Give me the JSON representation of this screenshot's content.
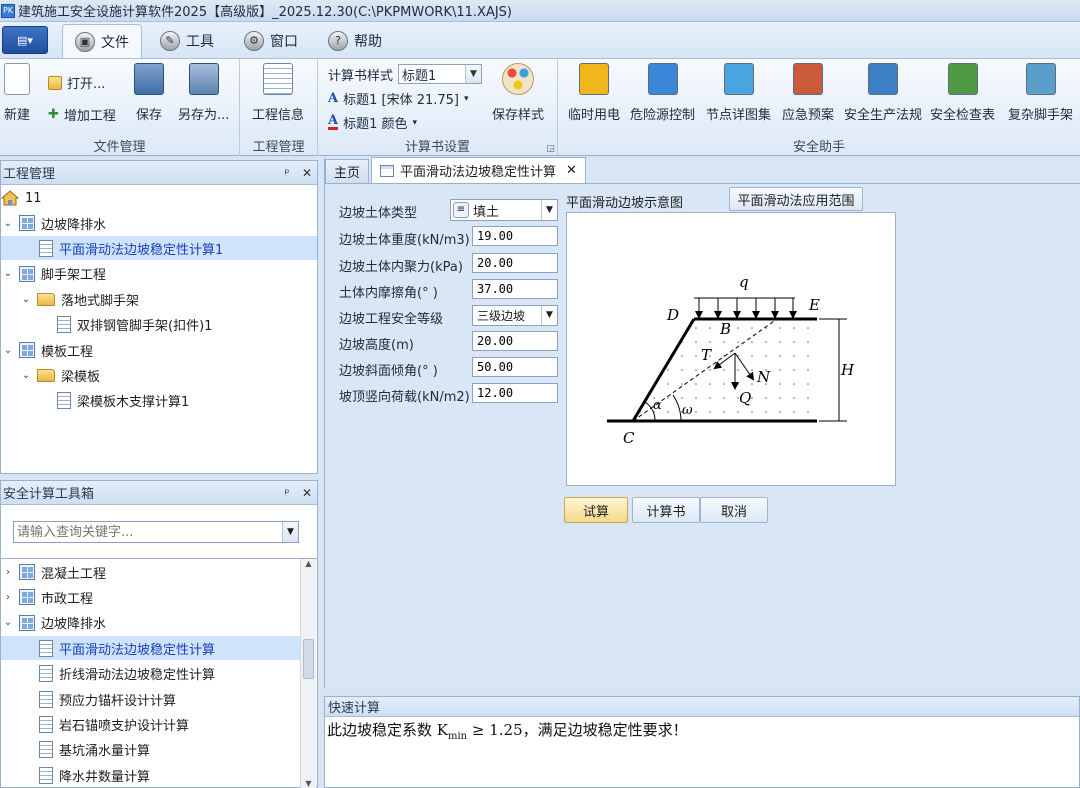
{
  "app": {
    "title": "建筑施工安全设施计算软件2025【高级版】_2025.12.30(C:\\PKPMWORK\\11.XAJS)",
    "icon_label": "PK"
  },
  "menu": {
    "app_button": "▤▾",
    "tabs": [
      {
        "label": "文件",
        "icon": "file-icon"
      },
      {
        "label": "工具",
        "icon": "wrench-icon"
      },
      {
        "label": "窗口",
        "icon": "gear-icon"
      },
      {
        "label": "帮助",
        "icon": "help-icon"
      }
    ]
  },
  "ribbon": {
    "file_group": {
      "label": "文件管理",
      "new": "新建",
      "open": "打开...",
      "add_project": "增加工程",
      "save": "保存",
      "save_as": "另存为..."
    },
    "project_group": {
      "label": "工程管理",
      "project_info": "工程信息"
    },
    "book_group": {
      "label": "计算书设置",
      "style_label": "计算书样式",
      "style_value": "标题1",
      "font_row": "标题1 [宋体 21.75]",
      "color_row": "标题1 颜色",
      "save_style": "保存样式"
    },
    "assistant_group": {
      "label": "安全助手",
      "buttons": [
        "临时用电",
        "危险源控制",
        "节点详图集",
        "应急预案",
        "安全生产法规",
        "安全检查表",
        "复杂脚手架"
      ],
      "colors": [
        "#f2b61d",
        "#3a86d9",
        "#4aa4e0",
        "#c95b3b",
        "#3b7fc4",
        "#4f9b45",
        "#5a9fc9"
      ]
    }
  },
  "project_panel": {
    "title": "工程管理",
    "pin": "ᵖ",
    "close": "✕",
    "root": "11",
    "items": [
      {
        "label": "边坡降排水",
        "type": "group",
        "expanded": "⌄"
      },
      {
        "label": "平面滑动法边坡稳定性计算1",
        "type": "doc",
        "selected": true
      },
      {
        "label": "脚手架工程",
        "type": "group",
        "expanded": "⌄"
      },
      {
        "label": "落地式脚手架",
        "type": "folder",
        "expanded": "⌄"
      },
      {
        "label": "双排钢管脚手架(扣件)1",
        "type": "doc"
      },
      {
        "label": "模板工程",
        "type": "group",
        "expanded": "⌄"
      },
      {
        "label": "梁模板",
        "type": "folder",
        "expanded": "⌄"
      },
      {
        "label": "梁模板木支撑计算1",
        "type": "doc"
      }
    ]
  },
  "toolbox_panel": {
    "title": "安全计算工具箱",
    "search_placeholder": "请输入查询关键字...",
    "items": [
      {
        "label": "混凝土工程",
        "type": "group",
        "expanded": "›"
      },
      {
        "label": "市政工程",
        "type": "group",
        "expanded": "›"
      },
      {
        "label": "边坡降排水",
        "type": "group",
        "expanded": "⌄"
      },
      {
        "label": "平面滑动法边坡稳定性计算",
        "type": "doc",
        "selected": true
      },
      {
        "label": "折线滑动法边坡稳定性计算",
        "type": "doc"
      },
      {
        "label": "预应力锚杆设计计算",
        "type": "doc"
      },
      {
        "label": "岩石锚喷支护设计计算",
        "type": "doc"
      },
      {
        "label": "基坑涌水量计算",
        "type": "doc"
      },
      {
        "label": "降水井数量计算",
        "type": "doc"
      }
    ]
  },
  "tabs": {
    "home": "主页",
    "active": "平面滑动法边坡稳定性计算",
    "close": "✕"
  },
  "form": {
    "soil_type_label": "边坡土体类型",
    "soil_type_value": "填土",
    "fields": [
      {
        "label": "边坡土体重度(kN/m3)",
        "value": "19.00"
      },
      {
        "label": "边坡土体内聚力(kPa)",
        "value": "20.00"
      },
      {
        "label": "土体内摩擦角(° )",
        "value": "37.00"
      }
    ],
    "grade_label": "边坡工程安全等级",
    "grade_value": "三级边坡",
    "fields2": [
      {
        "label": "边坡高度(m)",
        "value": "20.00"
      },
      {
        "label": "边坡斜面倾角(° )",
        "value": "50.00"
      },
      {
        "label": "坡顶竖向荷载(kN/m2)",
        "value": "12.00"
      }
    ]
  },
  "diagram": {
    "caption": "平面滑动边坡示意图",
    "scope_button": "平面滑动法应用范围",
    "labels": {
      "q": "q",
      "D": "D",
      "E": "E",
      "B": "B",
      "T": "T",
      "N": "N",
      "Q": "Q",
      "H": "H",
      "C": "C",
      "alpha": "α",
      "omega": "ω"
    }
  },
  "actions": {
    "calc": "试算",
    "book": "计算书",
    "cancel": "取消"
  },
  "quick": {
    "title": "快速计算",
    "msg_pre": "此边坡稳定系数 K",
    "msg_sub": "min",
    "msg_post": " ≥ 1.25，满足边坡稳定性要求！"
  }
}
